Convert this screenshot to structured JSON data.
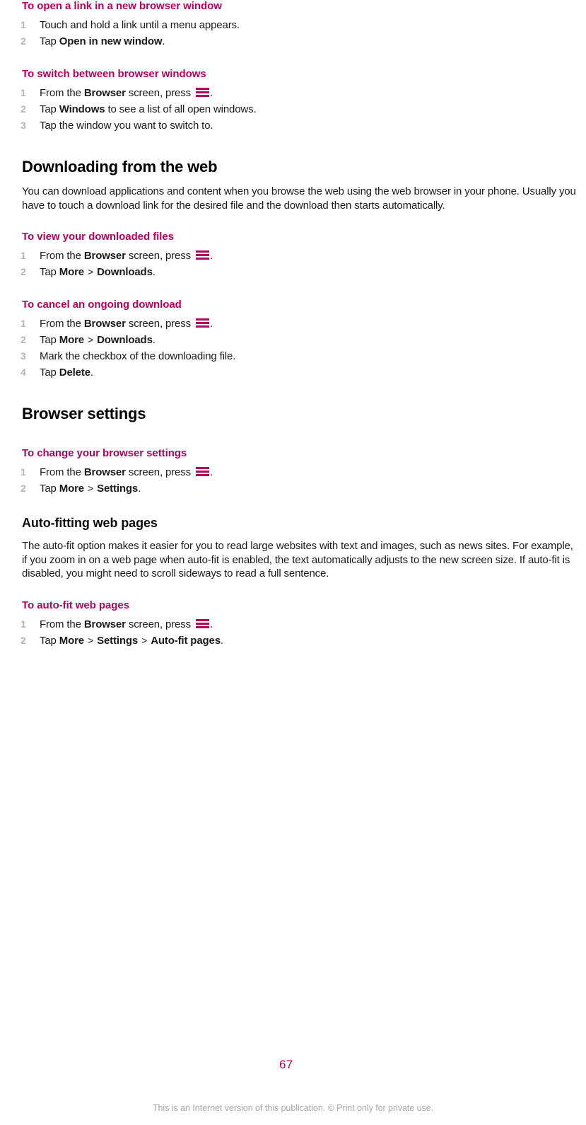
{
  "document": {
    "page_number": "67",
    "footer_note": "This is an Internet version of this publication. © Print only for private use.",
    "accent_color": "#b5005c",
    "step_number_color": "#b3b3b3",
    "body_color": "#1a1a1a"
  },
  "icons": {
    "menu_key": "menu-icon"
  },
  "blocks": {
    "task_open_link_new_window": {
      "heading": "To open a link in a new browser window",
      "steps": [
        {
          "lead": "Touch and hold a link until a menu appears."
        },
        {
          "lead": "Tap ",
          "bold": "Open in new window",
          "tail": "."
        }
      ]
    },
    "task_switch_windows": {
      "heading": "To switch between browser windows",
      "steps": [
        {
          "lead": "From the ",
          "bold": "Browser",
          "mid": " screen, press ",
          "icon": "menu-icon",
          "tail": "."
        },
        {
          "lead": "Tap ",
          "bold": "Windows",
          "tail": " to see a list of all open windows."
        },
        {
          "lead": "Tap the window you want to switch to."
        }
      ]
    },
    "section_downloading": {
      "title": "Downloading from the web",
      "intro": "You can download applications and content when you browse the web using the web browser in your phone. Usually you have to touch a download link for the desired file and the download then starts automatically."
    },
    "task_view_downloads": {
      "heading": "To view your downloaded files",
      "steps": [
        {
          "lead": "From the ",
          "bold": "Browser",
          "mid": " screen, press ",
          "icon": "menu-icon",
          "tail": "."
        },
        {
          "lead": "Tap ",
          "bold": "More",
          "chev": ">",
          "bold2": "Downloads",
          "tail": "."
        }
      ]
    },
    "task_cancel_download": {
      "heading": "To cancel an ongoing download",
      "steps": [
        {
          "lead": "From the ",
          "bold": "Browser",
          "mid": " screen, press ",
          "icon": "menu-icon",
          "tail": "."
        },
        {
          "lead": "Tap ",
          "bold": "More",
          "chev": ">",
          "bold2": "Downloads",
          "tail": "."
        },
        {
          "lead": "Mark the checkbox of the downloading file."
        },
        {
          "lead": "Tap ",
          "bold": "Delete",
          "tail": "."
        }
      ]
    },
    "section_browser_settings": {
      "title": "Browser settings"
    },
    "task_change_settings": {
      "heading": "To change your browser settings",
      "steps": [
        {
          "lead": "From the ",
          "bold": "Browser",
          "mid": " screen, press ",
          "icon": "menu-icon",
          "tail": "."
        },
        {
          "lead": "Tap ",
          "bold": "More",
          "chev": ">",
          "bold2": "Settings",
          "tail": "."
        }
      ]
    },
    "section_auto_fitting": {
      "title": "Auto-fitting web pages",
      "intro": "The auto-fit option makes it easier for you to read large websites with text and images, such as news sites. For example, if you zoom in on a web page when auto-fit is enabled, the text automatically adjusts to the new screen size. If auto-fit is disabled, you might need to scroll sideways to read a full sentence."
    },
    "task_auto_fit": {
      "heading": "To auto-fit web pages",
      "steps": [
        {
          "lead": "From the ",
          "bold": "Browser",
          "mid": " screen, press ",
          "icon": "menu-icon",
          "tail": "."
        },
        {
          "lead": "Tap ",
          "bold": "More",
          "chev": ">",
          "bold2": "Settings",
          "chev2": ">",
          "bold3": "Auto-fit pages",
          "tail": "."
        }
      ]
    }
  }
}
